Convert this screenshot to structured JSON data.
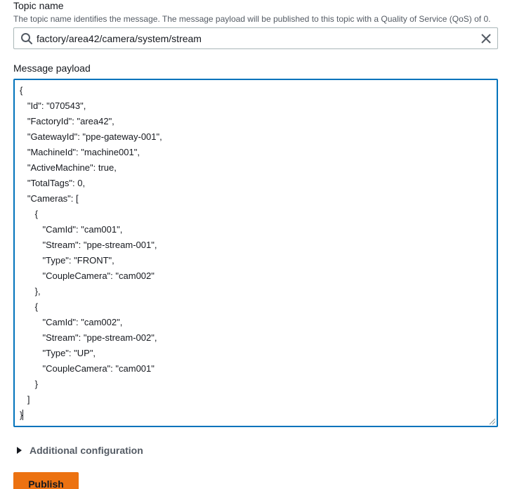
{
  "topic": {
    "label": "Topic name",
    "description": "The topic name identifies the message. The message payload will be published to this topic with a Quality of Service (QoS) of 0.",
    "value": "factory/area42/camera/system/stream"
  },
  "payload": {
    "label": "Message payload",
    "lines": [
      "{",
      "   \"Id\": \"070543\",",
      "   \"FactoryId\": \"area42\",",
      "   \"GatewayId\": \"ppe-gateway-001\",",
      "   \"MachineId\": \"machine001\",",
      "   \"ActiveMachine\": true,",
      "   \"TotalTags\": 0,",
      "   \"Cameras\": [",
      "      {",
      "         \"CamId\": \"cam001\",",
      "         \"Stream\": \"ppe-stream-001\",",
      "         \"Type\": \"FRONT\",",
      "         \"CoupleCamera\": \"cam002\"",
      "      },",
      "      {",
      "         \"CamId\": \"cam002\",",
      "         \"Stream\": \"ppe-stream-002\",",
      "         \"Type\": \"UP\",",
      "         \"CoupleCamera\": \"cam001\"",
      "      }",
      "   ]",
      "}"
    ]
  },
  "additional": {
    "label": "Additional configuration"
  },
  "publish": {
    "label": "Publish"
  },
  "colors": {
    "accent": "#ec7211",
    "focus": "#0073bb",
    "border": "#aab7b8"
  },
  "icons": {
    "search": "search-icon",
    "clear": "close-icon",
    "expand": "caret-right-icon"
  }
}
